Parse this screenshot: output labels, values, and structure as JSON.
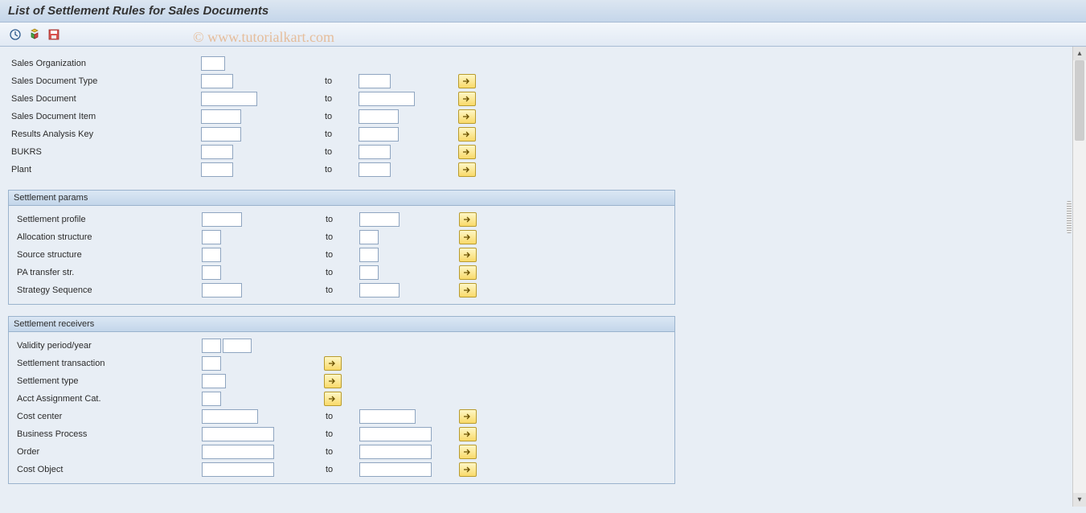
{
  "title": "List of Settlement Rules for Sales Documents",
  "watermark": "© www.tutorialkart.com",
  "toolbar": {
    "btn1_title": "Execute",
    "btn2_title": "Get Variant",
    "btn3_title": "Save as Variant"
  },
  "labels": {
    "to": "to"
  },
  "top": {
    "sales_org": "Sales Organization",
    "sales_doc_type": "Sales Document Type",
    "sales_doc": "Sales Document",
    "sales_doc_item": "Sales Document Item",
    "ra_key": "Results Analysis Key",
    "bukrs": "BUKRS",
    "plant": "Plant"
  },
  "group1": {
    "title": "Settlement params",
    "settle_profile": "Settlement profile",
    "alloc_struct": "Allocation structure",
    "source_struct": "Source structure",
    "pa_transfer": "PA transfer str.",
    "strategy": "Strategy Sequence"
  },
  "group2": {
    "title": "Settlement receivers",
    "validity": "Validity period/year",
    "settle_trans": "Settlement transaction",
    "settle_type": "Settlement type",
    "acct_assign": "Acct Assignment Cat.",
    "cost_center": "Cost center",
    "biz_process": "Business Process",
    "order": "Order",
    "cost_object": "Cost Object"
  }
}
